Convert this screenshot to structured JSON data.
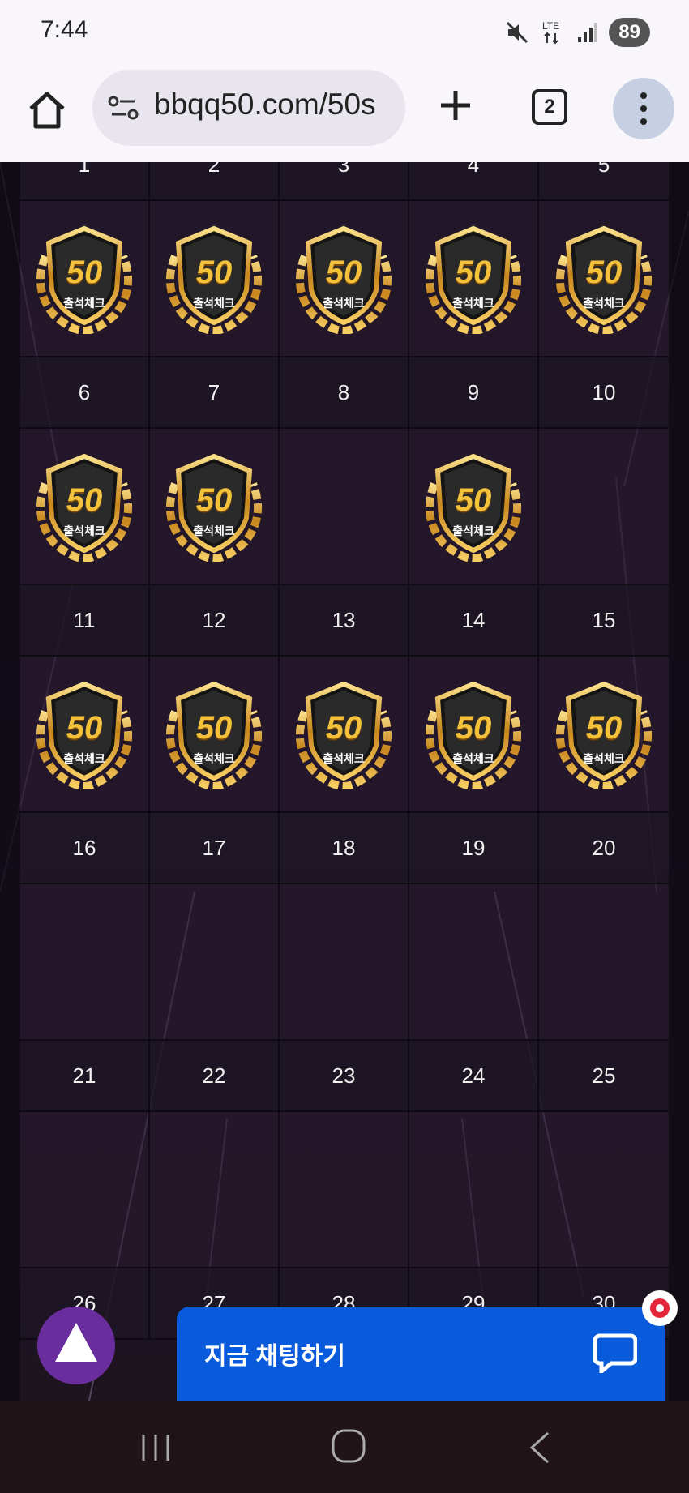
{
  "status_bar": {
    "time": "7:44",
    "network": "LTE",
    "battery": "89"
  },
  "browser": {
    "url": "bbqq50.com/50s",
    "tab_count": "2"
  },
  "calendar": {
    "badge_number": "50",
    "badge_label": "출석체크",
    "partial_top_row": [
      "1",
      "2",
      "3",
      "4",
      "5"
    ],
    "rows": [
      [
        "6",
        "7",
        "8",
        "9",
        "10"
      ],
      [
        "11",
        "12",
        "13",
        "14",
        "15"
      ],
      [
        "16",
        "17",
        "18",
        "19",
        "20"
      ],
      [
        "21",
        "22",
        "23",
        "24",
        "25"
      ],
      [
        "26",
        "27",
        "28",
        "29",
        "30"
      ]
    ],
    "checked_days_above": [
      true,
      true,
      true,
      true,
      true
    ],
    "checked_days": [
      [
        true,
        true,
        false,
        true,
        false
      ],
      [
        true,
        true,
        true,
        true,
        true
      ],
      [
        false,
        false,
        false,
        false,
        false
      ],
      [
        false,
        false,
        false,
        false,
        false
      ]
    ]
  },
  "chat": {
    "label": "지금 채팅하기"
  },
  "colors": {
    "chat_blue": "#0a5bdc",
    "scroll_btn_purple": "#6a2d9e",
    "badge_gold": "#f3c13b"
  }
}
